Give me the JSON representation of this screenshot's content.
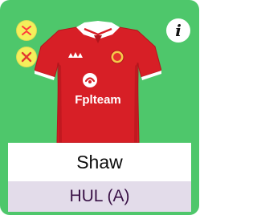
{
  "player": {
    "name": "Shaw",
    "fixture": "HUL (A)"
  },
  "shirt": {
    "sponsor": "Fplteam",
    "color": "#d71f26",
    "trim": "#ffffff"
  },
  "icons": {
    "swap": "swap-arrows-icon",
    "remove": "close-x-icon",
    "info": "info-icon"
  },
  "info_glyph": "i",
  "colors": {
    "card_background": "#4ec76b",
    "button_background": "#f4ef5b",
    "swap_icon": "#ff3b3b",
    "remove_icon": "#e23b2f"
  }
}
